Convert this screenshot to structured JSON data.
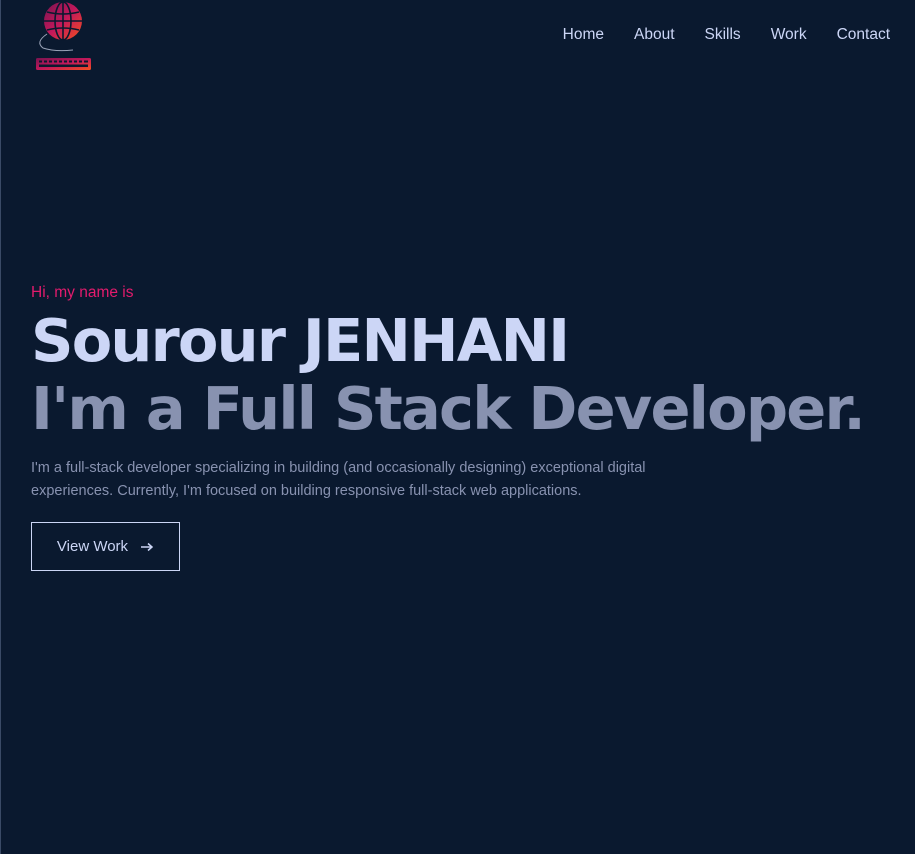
{
  "nav": {
    "items": [
      {
        "label": "Home"
      },
      {
        "label": "About"
      },
      {
        "label": "Skills"
      },
      {
        "label": "Work"
      },
      {
        "label": "Contact"
      }
    ]
  },
  "logo": {
    "icon": "globe-keyboard-logo"
  },
  "hero": {
    "greeting": "Hi, my name is",
    "name": "Sourour JENHANI",
    "role": "I'm a Full Stack Developer.",
    "description": "I'm a full-stack developer specializing in building (and occasionally designing) exceptional digital experiences. Currently, I'm focused on building responsive full-stack web applications."
  },
  "cta": {
    "label": "View Work",
    "icon": "arrow-right-icon"
  },
  "colors": {
    "background": "#0a192f",
    "accent": "#e31b6d",
    "heading": "#ccd6f6",
    "muted": "#8892b0"
  }
}
